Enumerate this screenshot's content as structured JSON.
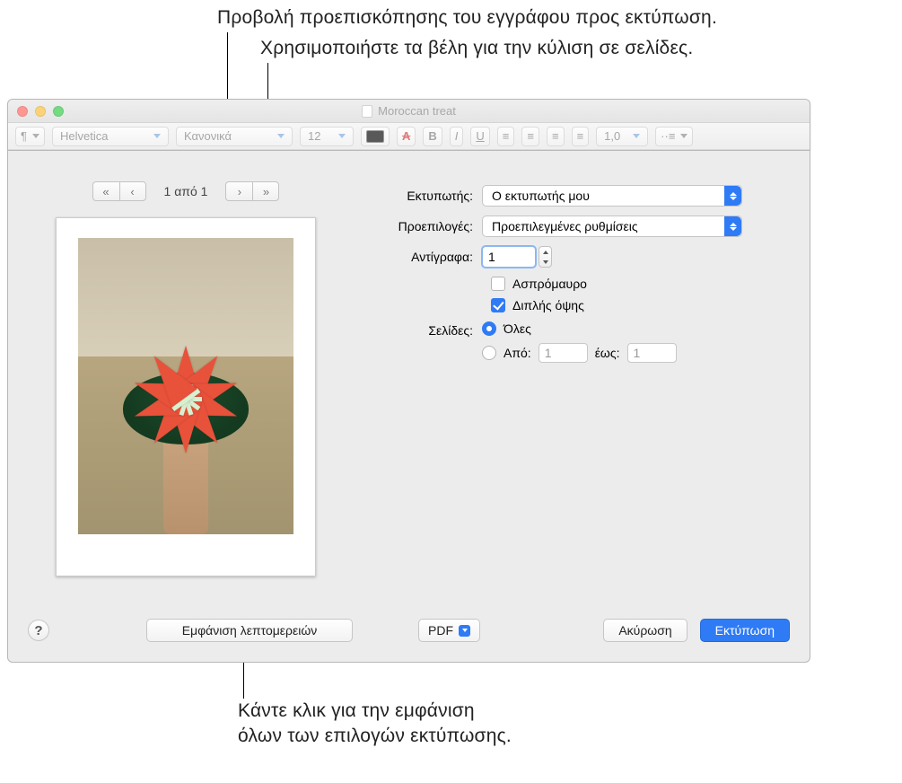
{
  "callouts": {
    "preview": "Προβολή προεπισκόπησης του εγγράφου προς εκτύπωση.",
    "arrows": "Χρησιμοποιήστε τα βέλη για την κύλιση σε σελίδες.",
    "details_line1": "Κάντε κλικ για την εμφάνιση",
    "details_line2": "όλων των επιλογών εκτύπωσης."
  },
  "window": {
    "title": "Moroccan treat"
  },
  "toolbar": {
    "font": "Helvetica",
    "weight": "Κανονικά",
    "size": "12",
    "spacing": "1,0"
  },
  "pager": {
    "indicator": "1 από 1"
  },
  "form": {
    "printer_label": "Εκτυπωτής:",
    "printer_value": "Ο εκτυπωτής μου",
    "presets_label": "Προεπιλογές:",
    "presets_value": "Προεπιλεγμένες ρυθμίσεις",
    "copies_label": "Αντίγραφα:",
    "copies_value": "1",
    "bw_label": "Ασπρόμαυρο",
    "duplex_label": "Διπλής όψης",
    "pages_label": "Σελίδες:",
    "pages_all": "Όλες",
    "pages_from": "Από:",
    "pages_to": "έως:",
    "from_value": "1",
    "to_value": "1"
  },
  "footer": {
    "details": "Εμφάνιση λεπτομερειών",
    "pdf": "PDF",
    "cancel": "Ακύρωση",
    "print": "Εκτύπωση"
  },
  "toolchars": {
    "pilcrow": "¶",
    "A": "A",
    "B": "B",
    "I": "I",
    "U": "U"
  }
}
